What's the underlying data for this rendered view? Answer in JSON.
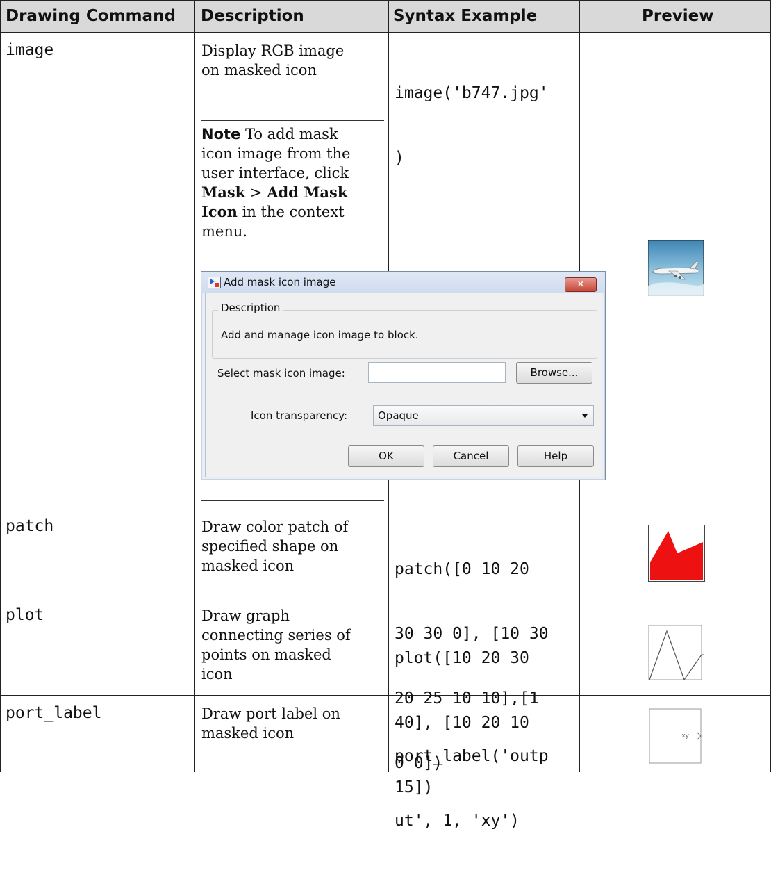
{
  "headers": [
    "Drawing Command",
    "Description",
    "Syntax Example",
    "Preview"
  ],
  "rows": {
    "image": {
      "command": "image",
      "description": [
        "Display RGB image",
        "on masked icon"
      ],
      "syntax": [
        "image('b747.jpg'",
        ")"
      ],
      "note": {
        "label": "Note",
        "lines": [
          " To add mask",
          "icon image from the",
          "user interface, click"
        ],
        "mask_bold": "Mask",
        "sep": " > ",
        "add_mask_bold": "Add Mask",
        "icon_bold": "Icon",
        "tail": " in the context",
        "last": "menu."
      },
      "dialog": {
        "title": "Add mask icon image",
        "close": "✕",
        "group_title": "Description",
        "group_text": "Add and manage icon image to block.",
        "select_label": "Select mask icon image:",
        "browse": "Browse...",
        "transparency_label": "Icon transparency:",
        "transparency_value": "Opaque",
        "ok": "OK",
        "cancel": "Cancel",
        "help": "Help"
      }
    },
    "patch": {
      "command": "patch",
      "description": [
        "Draw color patch of",
        "specified shape on",
        "masked icon"
      ],
      "syntax": [
        "patch([0 10 20",
        "30 30 0], [10 30",
        "20 25 10 10],[1",
        "0 0])"
      ]
    },
    "plot": {
      "command": "plot",
      "description": [
        "Draw graph",
        "connecting series of",
        "points on masked",
        "icon"
      ],
      "syntax": [
        "plot([10 20 30",
        "40], [10 20 10",
        "15])"
      ]
    },
    "port_label": {
      "command": "port_label",
      "description": [
        "Draw port label on",
        "masked icon"
      ],
      "syntax": [
        "port_label('outp",
        "ut', 1, 'xy')"
      ],
      "preview_label": "xy"
    }
  },
  "colors": {
    "header_bg": "#d9d9d9",
    "patch_red": "#ee1111",
    "plane_sky": "#6fa8c9"
  }
}
